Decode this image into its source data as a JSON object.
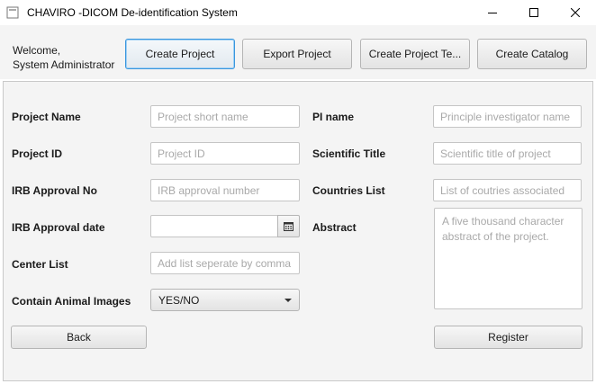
{
  "window": {
    "title": "CHAVIRO -DICOM De-identification System",
    "controls": [
      "minimize-icon",
      "maximize-icon",
      "close-icon"
    ]
  },
  "toolbar": {
    "welcome_line1": "Welcome,",
    "welcome_line2": "System Administrator",
    "buttons": [
      {
        "label": "Create Project",
        "active": true
      },
      {
        "label": "Export Project",
        "active": false
      },
      {
        "label": "Create Project Te...",
        "active": false
      },
      {
        "label": "Create Catalog",
        "active": false
      }
    ]
  },
  "form": {
    "project_name": {
      "label": "Project Name",
      "value": "",
      "placeholder": "Project short name"
    },
    "project_id": {
      "label": "Project ID",
      "value": "",
      "placeholder": "Project ID"
    },
    "irb_approval_no": {
      "label": "IRB Approval No",
      "value": "",
      "placeholder": "IRB approval number"
    },
    "irb_approval_date": {
      "label": "IRB Approval date",
      "value": "",
      "icon": "calendar-icon"
    },
    "center_list": {
      "label": "Center List",
      "value": "",
      "placeholder": "Add list seperate by comma"
    },
    "contain_animal_images": {
      "label": "Contain Animal Images",
      "selected": "YES/NO"
    },
    "pi_name": {
      "label": "PI name",
      "value": "",
      "placeholder": "Principle investigator name"
    },
    "scientific_title": {
      "label": "Scientific Title",
      "value": "",
      "placeholder": "Scientific title of project"
    },
    "countries_list": {
      "label": "Countries List",
      "value": "",
      "placeholder": "List of coutries associated"
    },
    "abstract": {
      "label": "Abstract",
      "value": "",
      "placeholder": "A five thousand character abstract of the project."
    }
  },
  "actions": {
    "back_label": "Back",
    "register_label": "Register"
  },
  "colors": {
    "panel_bg": "#f4f4f4",
    "focus_border": "#3a96dd",
    "placeholder": "#a9a9a9"
  }
}
